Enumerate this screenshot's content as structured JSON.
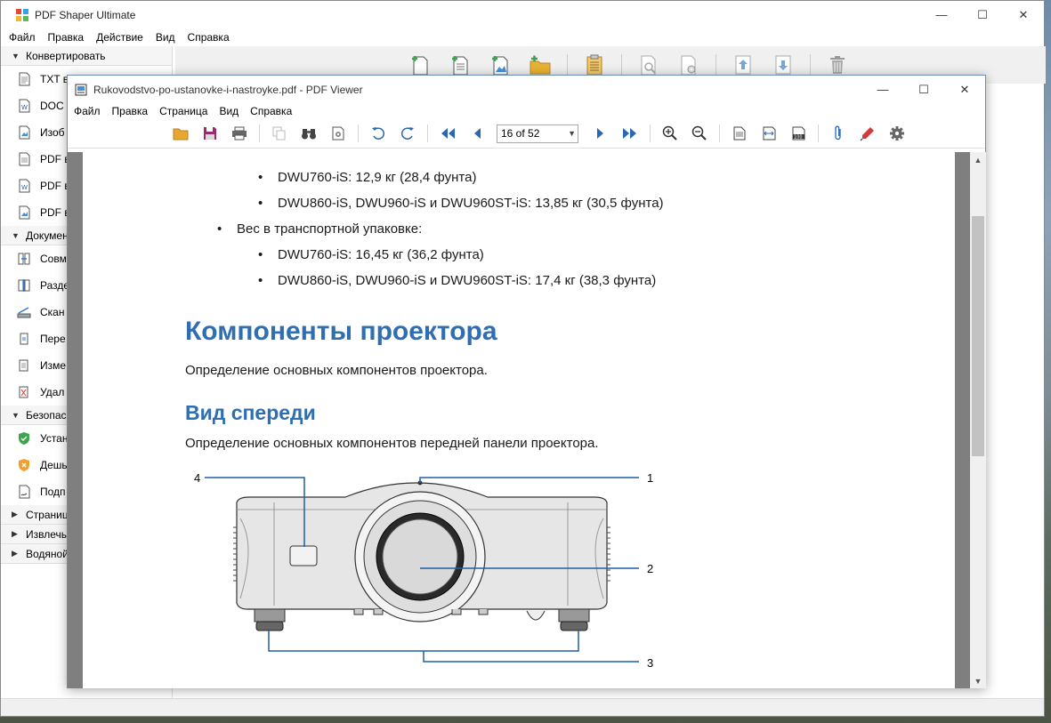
{
  "main_window": {
    "title": "PDF Shaper Ultimate",
    "menu": [
      "Файл",
      "Правка",
      "Действие",
      "Вид",
      "Справка"
    ]
  },
  "sidebar": {
    "groups": [
      {
        "label": "Конвертировать",
        "items": [
          "TXT в",
          "DOC",
          "Изоб",
          "PDF в",
          "PDF в",
          "PDF в"
        ]
      },
      {
        "label": "Докумен",
        "items": [
          "Совм",
          "Разде",
          "Скан",
          "Пере",
          "Изме",
          "Удал"
        ]
      },
      {
        "label": "Безопасн",
        "items": [
          "Устан",
          "Дешь",
          "Подп"
        ]
      },
      {
        "label": "Страниц",
        "items": []
      },
      {
        "label": "Извлечь",
        "items": []
      },
      {
        "label": "Водяной",
        "items": []
      }
    ]
  },
  "viewer": {
    "title": "Rukovodstvo-po-ustanovke-i-nastroyke.pdf - PDF Viewer",
    "menu": [
      "Файл",
      "Правка",
      "Страница",
      "Вид",
      "Справка"
    ],
    "page_indicator": "16 of 52"
  },
  "document": {
    "bullets": [
      {
        "level": 2,
        "text": "DWU760-iS: 12,9 кг (28,4 фунта)"
      },
      {
        "level": 2,
        "text": "DWU860-iS, DWU960-iS и DWU960ST-iS: 13,85 кг (30,5 фунта)"
      },
      {
        "level": 1,
        "text": "Вес в транспортной упаковке:"
      },
      {
        "level": 2,
        "text": "DWU760-iS: 16,45 кг (36,2 фунта)"
      },
      {
        "level": 2,
        "text": "DWU860-iS, DWU960-iS и DWU960ST-iS: 17,4 кг (38,3 фунта)"
      }
    ],
    "heading1": "Компоненты проектора",
    "para1": "Определение основных компонентов проектора.",
    "heading2": "Вид спереди",
    "para2": "Определение основных компонентов передней панели проектора.",
    "callouts": [
      "1",
      "2",
      "3",
      "4"
    ]
  },
  "colors": {
    "heading": "#2e6eb1",
    "callout_line": "#1f5fa8"
  }
}
